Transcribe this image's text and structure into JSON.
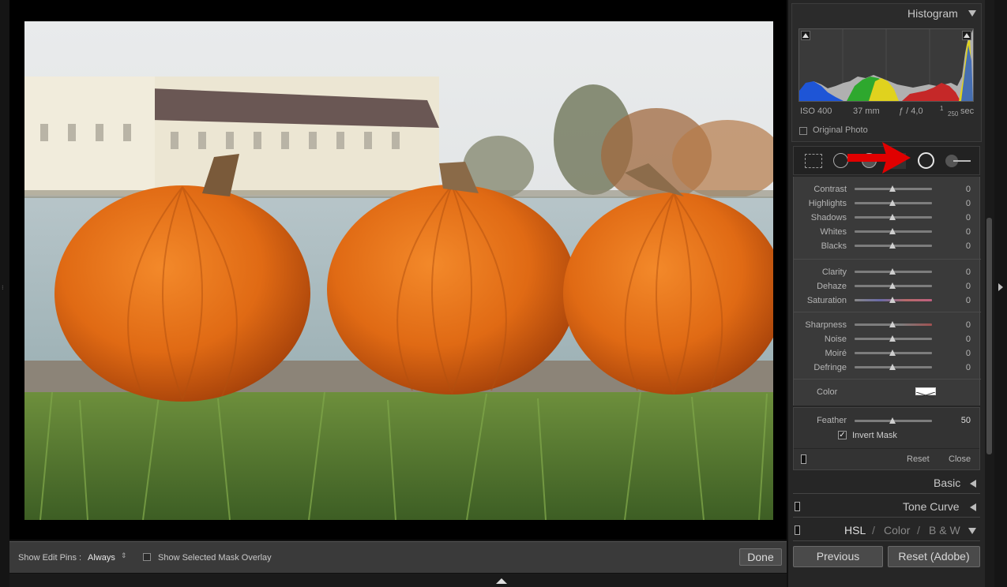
{
  "histogram": {
    "title": "Histogram",
    "iso": "ISO 400",
    "focal": "37 mm",
    "aperture": "ƒ / 4,0",
    "shutter_num": "1",
    "shutter_den": "250",
    "shutter_unit": "sec",
    "original_photo": "Original Photo"
  },
  "tools": [
    "crop-overlay-icon",
    "spot-removal-icon",
    "red-eye-icon",
    "graduated-filter-icon",
    "radial-filter-icon",
    "adjustment-brush-icon"
  ],
  "sliders_group1": [
    {
      "label": "Contrast",
      "value": "0"
    },
    {
      "label": "Highlights",
      "value": "0"
    },
    {
      "label": "Shadows",
      "value": "0"
    },
    {
      "label": "Whites",
      "value": "0"
    },
    {
      "label": "Blacks",
      "value": "0"
    }
  ],
  "sliders_group2": [
    {
      "label": "Clarity",
      "value": "0"
    },
    {
      "label": "Dehaze",
      "value": "0"
    },
    {
      "label": "Saturation",
      "value": "0"
    }
  ],
  "sliders_group3": [
    {
      "label": "Sharpness",
      "value": "0"
    },
    {
      "label": "Noise",
      "value": "0"
    },
    {
      "label": "Moiré",
      "value": "0"
    },
    {
      "label": "Defringe",
      "value": "0"
    }
  ],
  "color_label": "Color",
  "feather": {
    "label": "Feather",
    "value": "50"
  },
  "invert_mask": {
    "label": "Invert Mask",
    "checked": true
  },
  "panel_buttons": {
    "reset": "Reset",
    "close": "Close"
  },
  "sections": {
    "basic": "Basic",
    "tone_curve": "Tone Curve",
    "hsl": "HSL",
    "sep1": "/",
    "color": "Color",
    "sep2": "/",
    "bw": "B & W"
  },
  "bottom_buttons": {
    "previous": "Previous",
    "reset_adobe": "Reset (Adobe)"
  },
  "toolbar": {
    "show_edit_pins_label": "Show Edit Pins :",
    "show_edit_pins_value": "Always",
    "show_mask_overlay": "Show Selected Mask Overlay",
    "done": "Done"
  }
}
